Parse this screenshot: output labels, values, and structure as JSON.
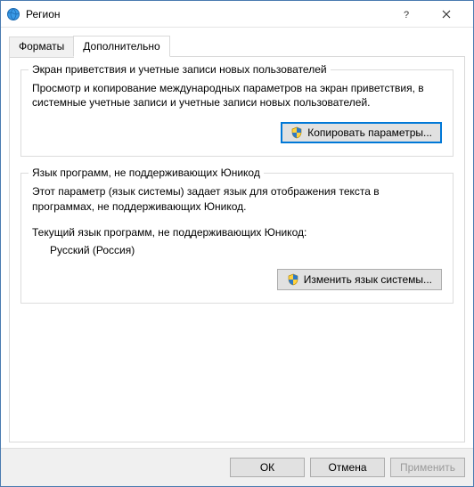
{
  "window": {
    "title": "Регион"
  },
  "tabs": {
    "formats": "Форматы",
    "advanced": "Дополнительно"
  },
  "group1": {
    "title": "Экран приветствия и учетные записи новых пользователей",
    "text": "Просмотр и копирование международных параметров на экран приветствия, в системные учетные записи и учетные записи новых пользователей.",
    "button": "Копировать параметры..."
  },
  "group2": {
    "title": "Язык программ, не поддерживающих Юникод",
    "text": "Этот параметр (язык системы) задает язык для отображения текста в программах, не поддерживающих Юникод.",
    "current_label": "Текущий язык программ, не поддерживающих Юникод:",
    "current_value": "Русский (Россия)",
    "button": "Изменить язык системы..."
  },
  "footer": {
    "ok": "ОК",
    "cancel": "Отмена",
    "apply": "Применить"
  }
}
